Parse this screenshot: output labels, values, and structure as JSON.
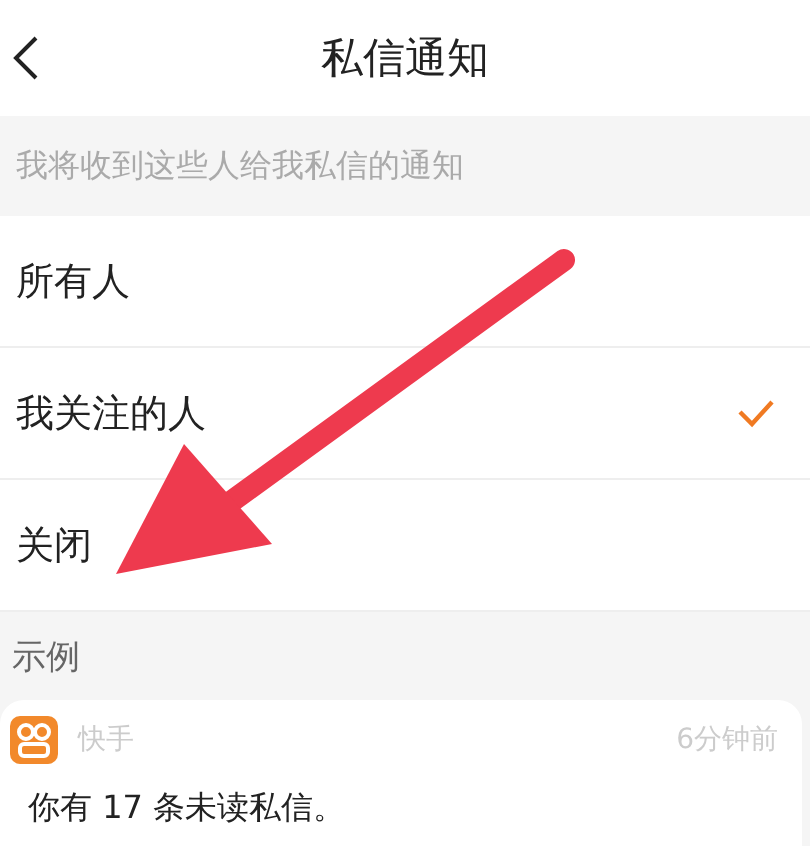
{
  "header": {
    "title": "私信通知"
  },
  "hint": "我将收到这些人给我私信的通知",
  "options": [
    {
      "label": "所有人",
      "selected": false
    },
    {
      "label": "我关注的人",
      "selected": true
    },
    {
      "label": "关闭",
      "selected": false
    }
  ],
  "example": {
    "heading": "示例",
    "app_name": "快手",
    "time": "6分钟前",
    "message": "你有 17 条未读私信。"
  }
}
